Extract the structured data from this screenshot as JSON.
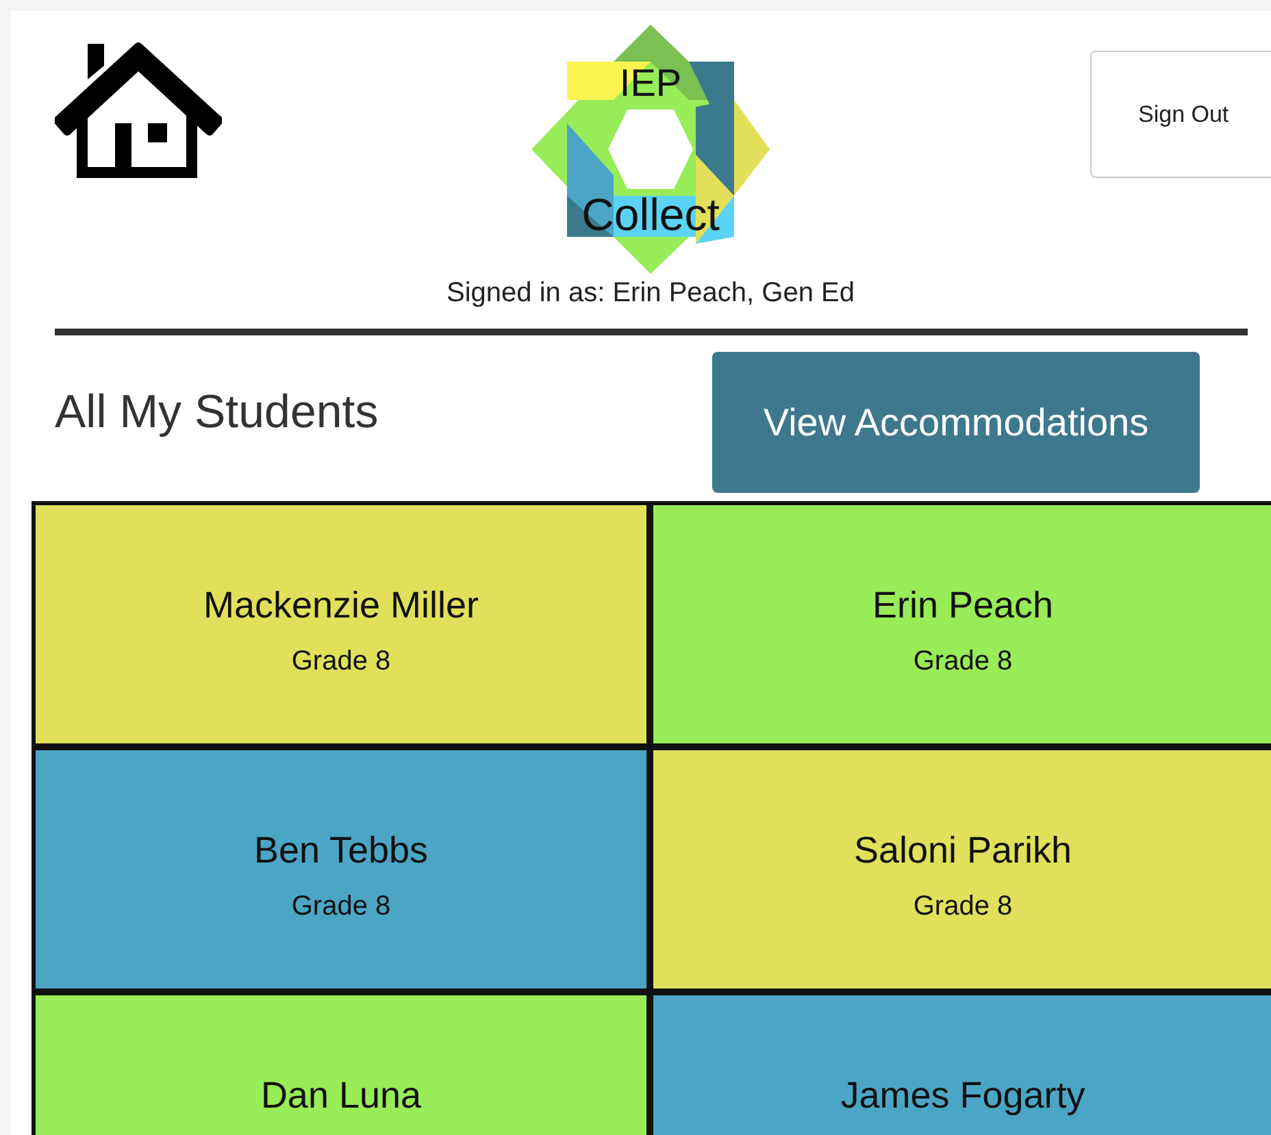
{
  "header": {
    "logo": {
      "top_text": "IEP",
      "bottom_text": "Collect"
    },
    "signed_in": "Signed in as: Erin Peach, Gen Ed",
    "sign_out": "Sign Out"
  },
  "title": "All My Students",
  "action_button": "View Accommodations",
  "students": [
    {
      "name": "Mackenzie Miller",
      "grade": "Grade 8",
      "color": "#e2e05a"
    },
    {
      "name": "Erin Peach",
      "grade": "Grade 8",
      "color": "#97ec57"
    },
    {
      "name": "Ben Tebbs",
      "grade": "Grade 8",
      "color": "#4ba6c5"
    },
    {
      "name": "Saloni Parikh",
      "grade": "Grade 8",
      "color": "#e2e05a"
    },
    {
      "name": "Dan Luna",
      "color": "#97ec57"
    },
    {
      "name": "James Fogarty",
      "color": "#4ba6c5"
    }
  ]
}
